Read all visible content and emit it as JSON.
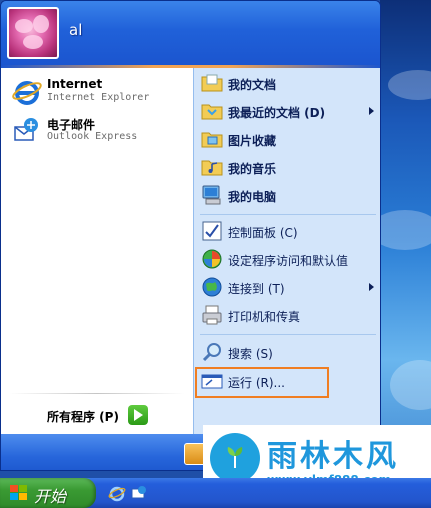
{
  "user": {
    "name": "al"
  },
  "pinned": [
    {
      "name": "Internet",
      "sub": "Internet Explorer",
      "icon": "internet-explorer-icon"
    },
    {
      "name": "电子邮件",
      "sub": "Outlook Express",
      "icon": "outlook-express-icon"
    }
  ],
  "all_programs": {
    "label": "所有程序 (P)"
  },
  "places": [
    {
      "label": "我的文档",
      "bold": true,
      "icon": "my-documents-icon"
    },
    {
      "label": "我最近的文档 (D)",
      "bold": true,
      "icon": "recent-documents-icon",
      "submenu": true
    },
    {
      "label": "图片收藏",
      "bold": true,
      "icon": "my-pictures-icon"
    },
    {
      "label": "我的音乐",
      "bold": true,
      "icon": "my-music-icon"
    },
    {
      "label": "我的电脑",
      "bold": true,
      "icon": "my-computer-icon"
    }
  ],
  "system": [
    {
      "label": "控制面板 (C)",
      "icon": "control-panel-icon"
    },
    {
      "label": "设定程序访问和默认值",
      "icon": "program-access-icon"
    },
    {
      "label": "连接到 (T)",
      "icon": "connect-to-icon",
      "submenu": true
    },
    {
      "label": "打印机和传真",
      "icon": "printers-faxes-icon"
    }
  ],
  "tools": [
    {
      "label": "搜索 (S)",
      "icon": "search-icon"
    },
    {
      "label": "运行 (R)...",
      "icon": "run-icon"
    }
  ],
  "taskbar": {
    "start_label": "开始"
  },
  "watermark": {
    "title": "雨林木风",
    "url": "www.ylmf888.com"
  },
  "colors": {
    "highlight": "#f07e22",
    "watermark": "#1f97dc"
  }
}
